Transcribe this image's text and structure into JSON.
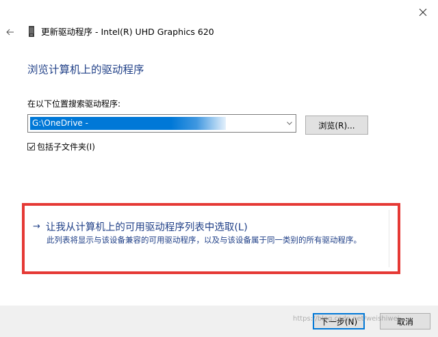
{
  "window": {
    "title": "更新驱动程序 - Intel(R) UHD Graphics 620",
    "icons": {
      "close": "close-icon",
      "back": "back-arrow-icon",
      "device": "device-icon"
    }
  },
  "main": {
    "heading": "浏览计算机上的驱动程序",
    "search_label": "在以下位置搜索驱动程序:",
    "path_value": "G:\\OneDrive -",
    "browse_label": "浏览(R)...",
    "include_subfolders_label": "包括子文件夹(I)",
    "include_subfolders_checked": true
  },
  "choose": {
    "title": "让我从计算机上的可用驱动程序列表中选取(L)",
    "description": "此列表将显示与该设备兼容的可用驱动程序，以及与该设备属于同一类别的所有驱动程序。",
    "highlight_color": "#e53935"
  },
  "footer": {
    "next_label": "下一步(N)",
    "cancel_label": "取消"
  },
  "watermark": {
    "text": "https://blog.csdn.net/weishiwei"
  },
  "colors": {
    "heading": "#1f3f87",
    "selection": "#0078d7",
    "footer_bg": "#f0f0f0"
  }
}
